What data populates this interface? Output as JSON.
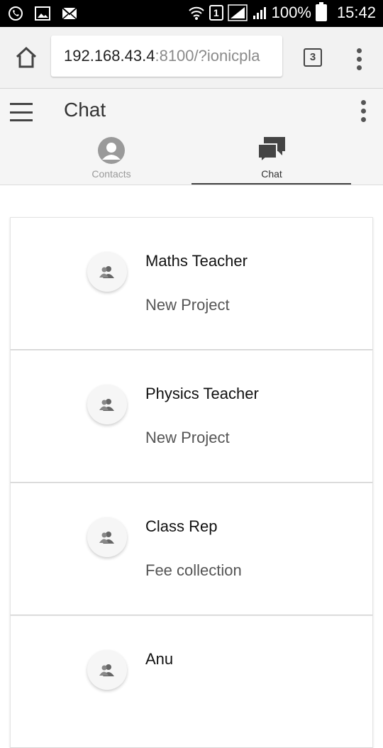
{
  "status_bar": {
    "left_icons": [
      "whatsapp-icon",
      "gallery-icon",
      "mail-icon"
    ],
    "sim": "1",
    "battery": "100%",
    "time": "15:42"
  },
  "browser": {
    "url_host": "192.168.43.4",
    "url_path": ":8100/?ionicpla",
    "tab_count": "3"
  },
  "header": {
    "title": "Chat",
    "tabs": [
      {
        "label": "Contacts",
        "active": false
      },
      {
        "label": "Chat",
        "active": true
      }
    ]
  },
  "chats": [
    {
      "name": "Maths Teacher",
      "subtitle": "New Project"
    },
    {
      "name": "Physics Teacher",
      "subtitle": "New Project"
    },
    {
      "name": "Class Rep",
      "subtitle": "Fee collection"
    },
    {
      "name": "Anu",
      "subtitle": ""
    }
  ],
  "colors": {
    "header_bg": "#f5f5f5",
    "active_tab": "#333333",
    "inactive_tab": "#9a9a9a"
  }
}
